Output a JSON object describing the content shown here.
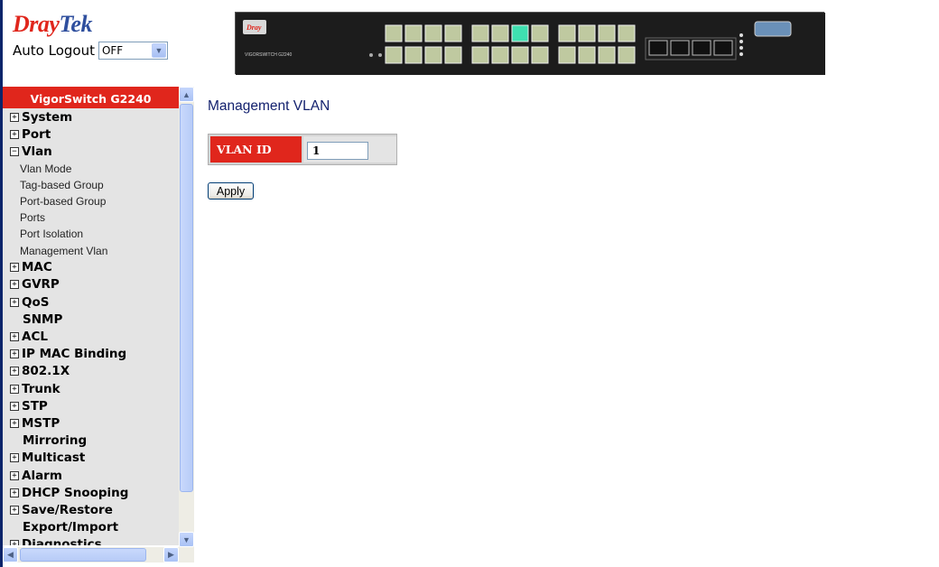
{
  "header": {
    "logo_part1": "Dray",
    "logo_part2": "Tek",
    "auto_logout_label": "Auto Logout",
    "auto_logout_value": "OFF",
    "device_model": "VIGORSWITCH G2240"
  },
  "sidebar": {
    "title": "VigorSwitch G2240",
    "items": [
      {
        "label": "System",
        "expandable": true
      },
      {
        "label": "Port",
        "expandable": true
      },
      {
        "label": "Vlan",
        "expandable": true,
        "expanded": true
      },
      {
        "label": "Vlan Mode",
        "sub": true
      },
      {
        "label": "Tag-based Group",
        "sub": true
      },
      {
        "label": "Port-based Group",
        "sub": true
      },
      {
        "label": "Ports",
        "sub": true
      },
      {
        "label": "Port Isolation",
        "sub": true
      },
      {
        "label": "Management Vlan",
        "sub": true
      },
      {
        "label": "MAC",
        "expandable": true
      },
      {
        "label": "GVRP",
        "expandable": true
      },
      {
        "label": "QoS",
        "expandable": true
      },
      {
        "label": "SNMP",
        "expandable": false
      },
      {
        "label": "ACL",
        "expandable": true
      },
      {
        "label": "IP MAC Binding",
        "expandable": true
      },
      {
        "label": "802.1X",
        "expandable": true
      },
      {
        "label": "Trunk",
        "expandable": true
      },
      {
        "label": "STP",
        "expandable": true
      },
      {
        "label": "MSTP",
        "expandable": true
      },
      {
        "label": "Mirroring",
        "expandable": false
      },
      {
        "label": "Multicast",
        "expandable": true
      },
      {
        "label": "Alarm",
        "expandable": true
      },
      {
        "label": "DHCP Snooping",
        "expandable": true
      },
      {
        "label": "Save/Restore",
        "expandable": true
      },
      {
        "label": "Export/Import",
        "expandable": false
      },
      {
        "label": "Diagnostics",
        "expandable": true
      }
    ]
  },
  "main": {
    "title": "Management VLAN",
    "vlan_id_label": "VLAN ID",
    "vlan_id_value": "1",
    "apply_label": "Apply"
  },
  "colors": {
    "brand_red": "#e0261c",
    "title_blue": "#13216e",
    "sidebar_bg": "#e4e4e4"
  }
}
